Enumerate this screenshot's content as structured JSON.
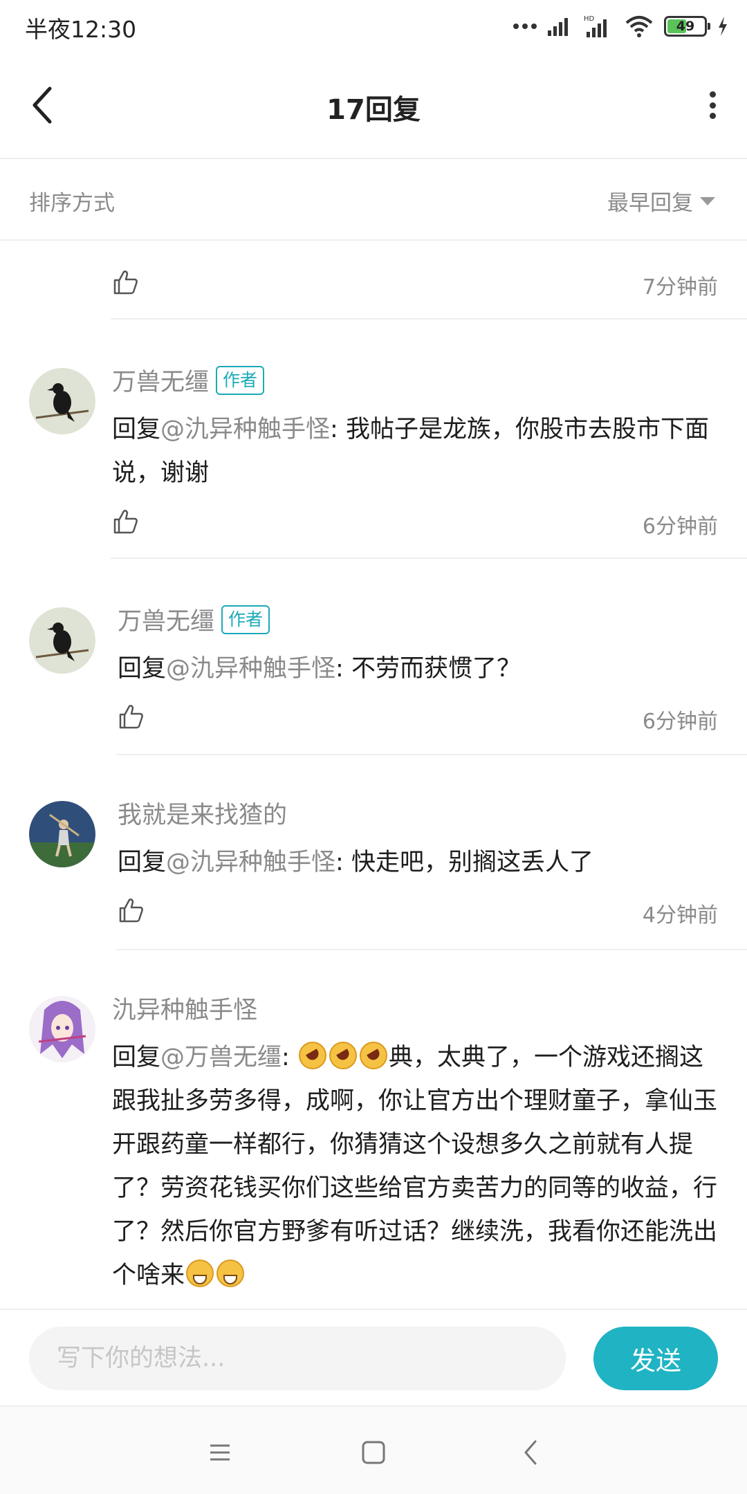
{
  "status_bar": {
    "time": "半夜12:30",
    "battery": "49"
  },
  "header": {
    "title": "17回复"
  },
  "sort": {
    "label": "排序方式",
    "value": "最早回复"
  },
  "first_row": {
    "time": "7分钟前"
  },
  "comments": [
    {
      "username": "万兽无缰",
      "badge": "作者",
      "reply_prefix": "回复",
      "mention": "@氿异种触手怪",
      "text": ": 我帖子是龙族，你股市去股市下面说，谢谢",
      "time": "6分钟前"
    },
    {
      "username": "万兽无缰",
      "badge": "作者",
      "reply_prefix": "回复",
      "mention": "@氿异种触手怪",
      "text": ": 不劳而获惯了？",
      "time": "6分钟前"
    },
    {
      "username": "我就是来找猹的",
      "reply_prefix": "回复",
      "mention": "@氿异种触手怪",
      "text": ": 快走吧，别搁这丢人了",
      "time": "4分钟前"
    },
    {
      "username": "氿异种触手怪",
      "reply_prefix": "回复",
      "mention": "@万兽无缰",
      "text_before": ": ",
      "text_after": "典，太典了，一个游戏还搁这跟我扯多劳多得，成啊，你让官方出个理财童子，拿仙玉开跟药童一样都行，你猜猜这个设想多久之前就有人提了？劳资花钱买你们这些给官方卖苦力的同等的收益，行了？然后你官方野爹有听过话？继续洗，我看你还能洗出个啥来"
    }
  ],
  "composer": {
    "placeholder": "写下你的想法...",
    "send_label": "发送"
  },
  "colors": {
    "accent": "#1fb3c3",
    "badge": "#1aaab8",
    "muted": "#8a8a8a"
  },
  "icons": [
    "back-arrow-icon",
    "more-vertical-icon",
    "caret-down-icon",
    "thumb-up-icon",
    "menu-icon",
    "home-square-icon",
    "back-nav-icon"
  ]
}
